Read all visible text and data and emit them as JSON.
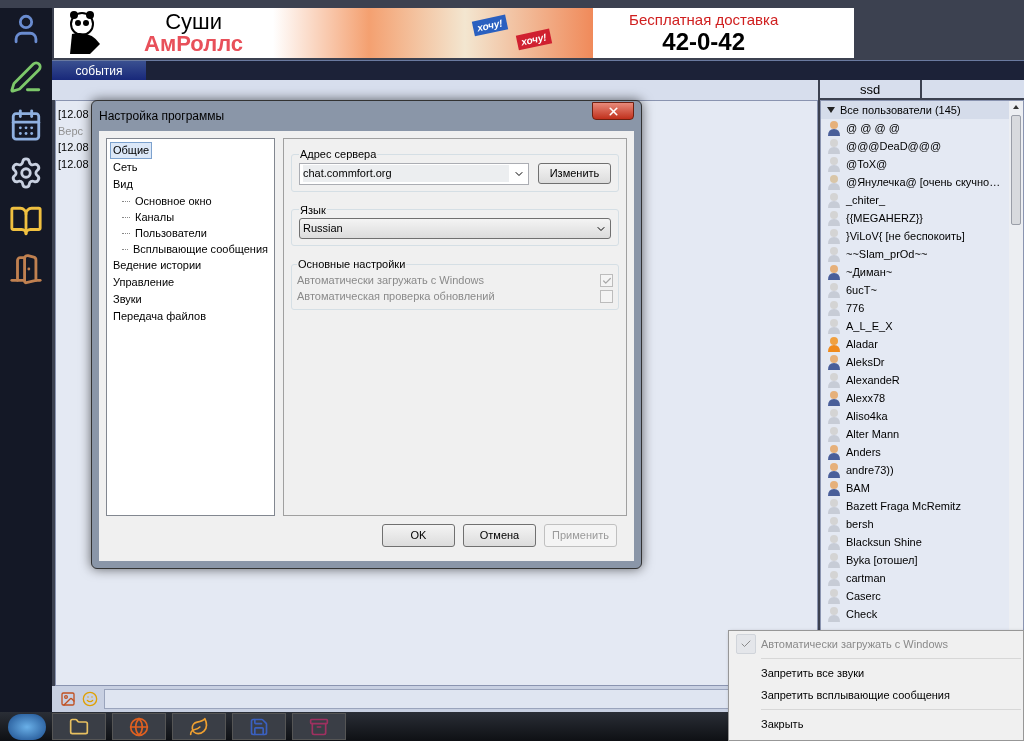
{
  "banner": {
    "title": "Суши",
    "brand": "АмРоллс",
    "stickers": [
      "хочу!",
      "хочу!"
    ],
    "promo": "Бесплатная доставка",
    "phone": "42-0-42"
  },
  "tabs": [
    {
      "label": "события",
      "selected": true
    }
  ],
  "chat_log": [
    {
      "kind": "message",
      "text": "[12.08"
    },
    {
      "kind": "system",
      "text": "Верс"
    },
    {
      "kind": "message",
      "text": "[12.08"
    },
    {
      "kind": "message",
      "text": "[12.08"
    }
  ],
  "user_list": {
    "columns": [
      "ssd"
    ],
    "group": {
      "label": "Все пользователи (145)",
      "expanded": true
    },
    "users": [
      {
        "name": "@ @ @ @",
        "kind": "male",
        "dimmed": false
      },
      {
        "name": "@@@DeaD@@@",
        "kind": "male",
        "dimmed": true
      },
      {
        "name": "@ToX@",
        "kind": "male",
        "dimmed": true
      },
      {
        "name": "@Янулечка@ [очень скучно…",
        "kind": "female",
        "dimmed": true
      },
      {
        "name": "_chiter_",
        "kind": "male",
        "dimmed": true
      },
      {
        "name": "{{MEGAHERZ}}",
        "kind": "male",
        "dimmed": true
      },
      {
        "name": "}ViLoV{ [не беспокоить]",
        "kind": "male",
        "dimmed": true
      },
      {
        "name": "~~Slam_prOd~~",
        "kind": "male",
        "dimmed": true
      },
      {
        "name": "~Диман~",
        "kind": "male",
        "dimmed": false
      },
      {
        "name": "6ucT~",
        "kind": "male",
        "dimmed": true
      },
      {
        "name": "776",
        "kind": "male",
        "dimmed": true
      },
      {
        "name": "A_L_E_X",
        "kind": "male",
        "dimmed": true
      },
      {
        "name": "Aladar",
        "kind": "female",
        "dimmed": false
      },
      {
        "name": "AleksDr",
        "kind": "male",
        "dimmed": false
      },
      {
        "name": "AlexandeR",
        "kind": "male",
        "dimmed": true
      },
      {
        "name": "Alexx78",
        "kind": "male",
        "dimmed": false
      },
      {
        "name": "Aliso4ka",
        "kind": "male",
        "dimmed": true
      },
      {
        "name": "Alter Mann",
        "kind": "male",
        "dimmed": true
      },
      {
        "name": "Anders",
        "kind": "male",
        "dimmed": false
      },
      {
        "name": "andre73))",
        "kind": "male",
        "dimmed": false
      },
      {
        "name": "BAM",
        "kind": "male",
        "dimmed": false
      },
      {
        "name": "Bazett Fraga McRemitz",
        "kind": "male",
        "dimmed": true
      },
      {
        "name": "bersh",
        "kind": "male",
        "dimmed": true
      },
      {
        "name": "Blacksun Shine",
        "kind": "male",
        "dimmed": true
      },
      {
        "name": "Byka [отошел]",
        "kind": "male",
        "dimmed": true
      },
      {
        "name": "cartman",
        "kind": "male",
        "dimmed": true
      },
      {
        "name": "Caserc",
        "kind": "male",
        "dimmed": true
      },
      {
        "name": "Check",
        "kind": "male",
        "dimmed": true
      }
    ]
  },
  "dialog": {
    "title": "Настройка программы",
    "tree": [
      {
        "label": "Общие",
        "selected": true
      },
      {
        "label": "Сеть",
        "selected": false
      },
      {
        "label": "Вид",
        "selected": false,
        "children": [
          {
            "label": "Основное окно",
            "selected": false
          },
          {
            "label": "Каналы",
            "selected": false
          },
          {
            "label": "Пользователи",
            "selected": false
          },
          {
            "label": "Всплывающие сообщения",
            "selected": false
          }
        ]
      },
      {
        "label": "Ведение истории",
        "selected": false
      },
      {
        "label": "Управление",
        "selected": false
      },
      {
        "label": "Звуки",
        "selected": false
      },
      {
        "label": "Передача файлов",
        "selected": false
      }
    ],
    "server": {
      "label": "Адрес сервера",
      "value": "chat.commfort.org",
      "button": "Изменить"
    },
    "language": {
      "label": "Язык",
      "value": "Russian"
    },
    "basic": {
      "label": "Основные настройки",
      "options": [
        {
          "label": "Автоматически загружать с Windows",
          "checked": true,
          "disabled": true
        },
        {
          "label": "Автоматическая проверка обновлений",
          "checked": false,
          "disabled": true
        }
      ]
    },
    "buttons": [
      {
        "label": "OK",
        "disabled": false
      },
      {
        "label": "Отмена",
        "disabled": false
      },
      {
        "label": "Применить",
        "disabled": true
      }
    ]
  },
  "context_menu": [
    {
      "kind": "check",
      "label": "Автоматически загружать с Windows",
      "checked": true,
      "disabled": true
    },
    {
      "kind": "separator"
    },
    {
      "kind": "item",
      "label": "Запретить все звуки",
      "disabled": false
    },
    {
      "kind": "item",
      "label": "Запретить всплывающие сообщения",
      "disabled": false
    },
    {
      "kind": "separator"
    },
    {
      "kind": "item",
      "label": "Закрыть",
      "disabled": false
    }
  ]
}
